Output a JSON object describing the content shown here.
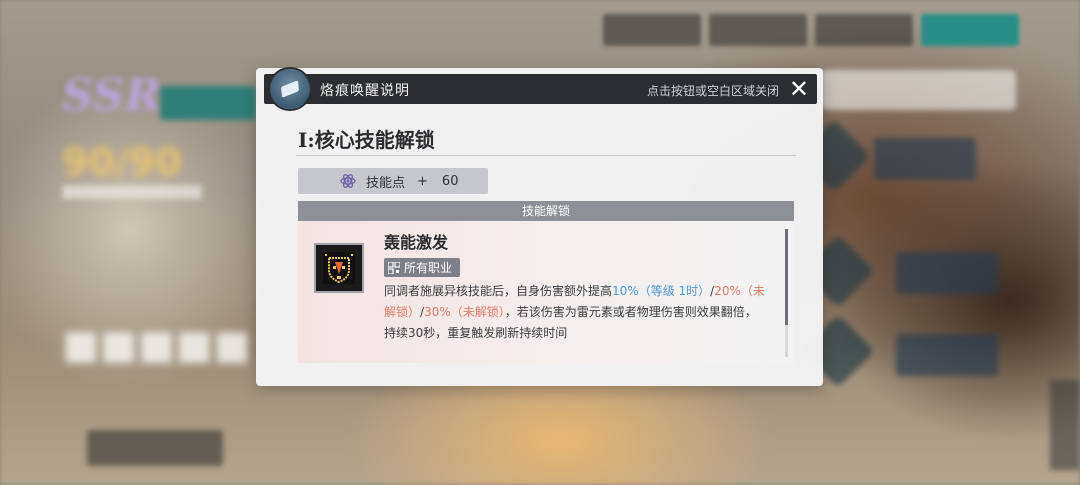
{
  "dialog": {
    "title": "烙痕唤醒说明",
    "close_hint": "点击按钮或空白区域关闭",
    "close_symbol": "✕",
    "section_title": "I:核心技能解锁",
    "skill_points": {
      "label": "技能点",
      "plus": "+",
      "value": "60"
    },
    "unlock": {
      "header": "技能解锁",
      "skill": {
        "name": "轰能激发",
        "class_badge": "所有职业",
        "desc_parts": [
          {
            "text": "同调者施展异核技能后，自身伤害额外提高",
            "style": "normal"
          },
          {
            "text": "10%（等级 1时）",
            "style": "blue"
          },
          {
            "text": "/",
            "style": "normal"
          },
          {
            "text": "20%（未解锁）",
            "style": "red"
          },
          {
            "text": "/",
            "style": "normal"
          },
          {
            "text": "30%（未解锁）",
            "style": "red"
          },
          {
            "text": "，若该伤害为雷元素或者物理伤害则效果翻倍， 持续30秒，重复触发刷新持续时间",
            "style": "normal"
          }
        ]
      }
    }
  },
  "colors": {
    "header_bg": "#2b2d31",
    "accent_blue": "#4a9ad6",
    "locked_red": "#e47b66",
    "active_tab": "#2a8f86"
  },
  "icons": {
    "logo": "crystal-emblem-icon",
    "skill_points": "atom-icon",
    "class_badge": "qr-grid-icon",
    "skill": "pixel-shield-skill-icon"
  }
}
